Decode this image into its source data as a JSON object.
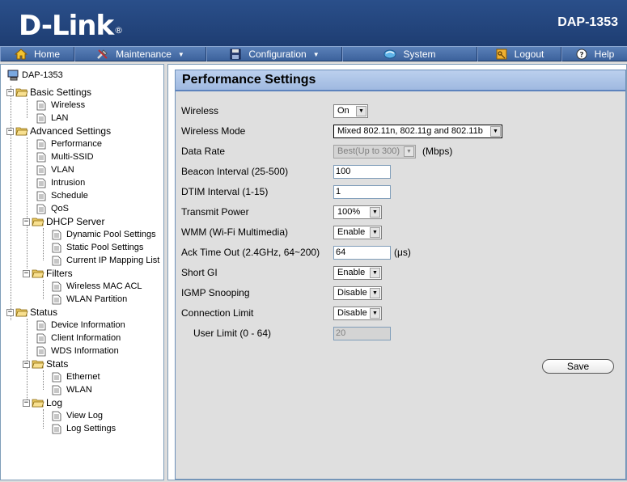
{
  "header": {
    "logo": "D-Link",
    "logo_mark": "®",
    "model": "DAP-1353"
  },
  "nav": {
    "home": "Home",
    "maintenance": "Maintenance",
    "configuration": "Configuration",
    "system": "System",
    "logout": "Logout",
    "help": "Help",
    "dropdown_arrow": "▼"
  },
  "sidebar": {
    "root": "DAP-1353",
    "basic_settings": "Basic Settings",
    "wireless": "Wireless",
    "lan": "LAN",
    "advanced_settings": "Advanced Settings",
    "performance": "Performance",
    "multi_ssid": "Multi-SSID",
    "vlan": "VLAN",
    "intrusion": "Intrusion",
    "schedule": "Schedule",
    "qos": "QoS",
    "dhcp_server": "DHCP Server",
    "dynamic_pool": "Dynamic Pool Settings",
    "static_pool": "Static Pool Settings",
    "current_ip": "Current IP Mapping List",
    "filters": "Filters",
    "wireless_mac_acl": "Wireless MAC ACL",
    "wlan_partition": "WLAN Partition",
    "status": "Status",
    "device_info": "Device Information",
    "client_info": "Client Information",
    "wds_info": "WDS Information",
    "stats": "Stats",
    "ethernet": "Ethernet",
    "wlan": "WLAN",
    "log": "Log",
    "view_log": "View Log",
    "log_settings": "Log Settings",
    "collapse_symbol": "−"
  },
  "main": {
    "title": "Performance Settings",
    "fields": {
      "wireless": {
        "label": "Wireless",
        "value": "On"
      },
      "wireless_mode": {
        "label": "Wireless Mode",
        "value": "Mixed 802.11n, 802.11g and 802.11b"
      },
      "data_rate": {
        "label": "Data Rate",
        "value": "Best(Up to 300)",
        "unit": "(Mbps)"
      },
      "beacon_interval": {
        "label": "Beacon Interval (25-500)",
        "value": "100"
      },
      "dtim_interval": {
        "label": "DTIM Interval (1-15)",
        "value": "1"
      },
      "transmit_power": {
        "label": "Transmit Power",
        "value": "100%"
      },
      "wmm": {
        "label": "WMM (Wi-Fi Multimedia)",
        "value": "Enable"
      },
      "ack_timeout": {
        "label": "Ack Time Out  (2.4GHz, 64~200)",
        "value": "64",
        "unit": "(μs)"
      },
      "short_gi": {
        "label": "Short GI",
        "value": "Enable"
      },
      "igmp_snooping": {
        "label": "IGMP Snooping",
        "value": "Disable"
      },
      "connection_limit": {
        "label": "Connection Limit",
        "value": "Disable"
      },
      "user_limit": {
        "label": "User Limit (0 - 64)",
        "value": "20"
      }
    },
    "save_label": "Save"
  },
  "colors": {
    "header_bg": "#1e3d72",
    "nav_bg": "#4a70aa",
    "panel_title_bg": "#b0c6ea",
    "panel_bg": "#dfdfdf"
  }
}
